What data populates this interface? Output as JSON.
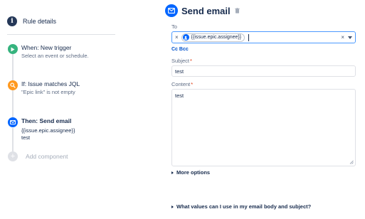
{
  "rule_panel": {
    "header": {
      "title": "Rule details",
      "icon": "info-icon"
    },
    "steps": [
      {
        "title": "When: New trigger",
        "subtitle": "Select an event or schedule.",
        "icon": "play-icon",
        "color": "#36b37e"
      },
      {
        "title": "If: Issue matches JQL",
        "subtitle": "\"Epic link\" is not empty",
        "icon": "search-icon",
        "color": "#ff991f"
      },
      {
        "title": "Then: Send email",
        "subtitle_lines": [
          "{{issue.epic.assignee}}",
          "test"
        ],
        "icon": "mail-icon",
        "color": "#0065ff",
        "selected": true
      }
    ],
    "add_component": {
      "label": "Add component",
      "icon": "plus-icon"
    }
  },
  "email_form": {
    "title": "Send email",
    "header_icon": "mail-icon",
    "delete_icon": "trash-icon",
    "to": {
      "label": "To",
      "chip": {
        "text": "{{issue.epic.assignee}}",
        "icon": "user-avatar-icon"
      },
      "value": ""
    },
    "cc_bcc_label": "Cc Bcc",
    "subject": {
      "label": "Subject",
      "required": true,
      "value": "test"
    },
    "content": {
      "label": "Content",
      "required": true,
      "value": "test"
    },
    "more_options": "More options",
    "help_question": "What values can I use in my email body and subject?"
  },
  "colors": {
    "accent": "#0065ff",
    "link": "#0052cc",
    "required": "#de350b",
    "focus_border": "#4c9aff"
  }
}
